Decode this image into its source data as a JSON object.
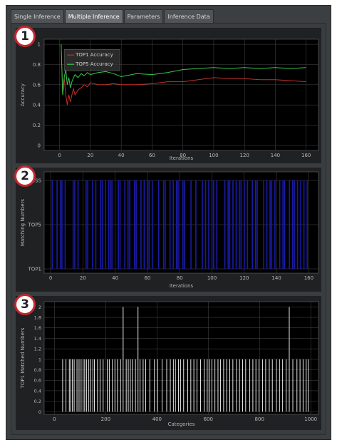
{
  "tabs": [
    {
      "label": "Single Inference"
    },
    {
      "label": "Multiple Inference"
    },
    {
      "label": "Parameters"
    },
    {
      "label": "Inference Data"
    }
  ],
  "active_tab": 1,
  "markers": [
    "1",
    "2",
    "3"
  ],
  "chart_data": [
    {
      "type": "line",
      "xlabel": "Iterations",
      "ylabel": "Accuracy",
      "xlim": [
        -10,
        168
      ],
      "ylim": [
        -0.05,
        1.05
      ],
      "xticks": [
        "0",
        "20",
        "40",
        "60",
        "80",
        "100",
        "120",
        "140",
        "160"
      ],
      "yticks": [
        "0",
        "0.2",
        "0.4",
        "0.6",
        "0.8",
        "1"
      ],
      "legend": [
        "TOP1 Accuracy",
        "TOP5 Accuracy"
      ],
      "legend_position": "top-left",
      "grid": true,
      "series": [
        {
          "name": "TOP1 Accuracy",
          "color": "#c4302b",
          "x": [
            1,
            2,
            3,
            4,
            5,
            6,
            7,
            8,
            9,
            10,
            12,
            14,
            16,
            18,
            20,
            25,
            30,
            35,
            40,
            50,
            60,
            70,
            80,
            90,
            100,
            110,
            120,
            130,
            140,
            150,
            160
          ],
          "y": [
            1.0,
            0.5,
            0.67,
            0.5,
            0.4,
            0.5,
            0.43,
            0.5,
            0.56,
            0.5,
            0.55,
            0.57,
            0.6,
            0.58,
            0.62,
            0.6,
            0.6,
            0.61,
            0.6,
            0.6,
            0.61,
            0.63,
            0.63,
            0.65,
            0.67,
            0.66,
            0.66,
            0.65,
            0.65,
            0.64,
            0.63
          ]
        },
        {
          "name": "TOP5 Accuracy",
          "color": "#35c94a",
          "x": [
            1,
            2,
            3,
            4,
            5,
            6,
            7,
            8,
            9,
            10,
            12,
            14,
            16,
            18,
            20,
            25,
            30,
            35,
            40,
            50,
            60,
            70,
            80,
            90,
            100,
            110,
            120,
            130,
            140,
            150,
            160
          ],
          "y": [
            1.0,
            0.5,
            0.67,
            0.75,
            0.6,
            0.67,
            0.57,
            0.63,
            0.67,
            0.7,
            0.67,
            0.71,
            0.69,
            0.72,
            0.7,
            0.72,
            0.73,
            0.71,
            0.68,
            0.71,
            0.7,
            0.72,
            0.75,
            0.76,
            0.77,
            0.76,
            0.77,
            0.76,
            0.77,
            0.76,
            0.77
          ]
        }
      ]
    },
    {
      "type": "bar",
      "xlabel": "Iterations",
      "ylabel": "Matching Numbers",
      "xlim": [
        -4,
        166
      ],
      "xticks": [
        "0",
        "20",
        "40",
        "60",
        "80",
        "100",
        "120",
        "140",
        "160"
      ],
      "categories": [
        "TOP1",
        "TOP5",
        "MISS"
      ],
      "grid": true,
      "bar_color": "#1a1aa8",
      "x": [
        1,
        4,
        6,
        7,
        9,
        14,
        15,
        17,
        22,
        23,
        26,
        28,
        31,
        32,
        34,
        36,
        37,
        38,
        42,
        43,
        46,
        48,
        49,
        52,
        53,
        56,
        58,
        60,
        61,
        63,
        67,
        70,
        71,
        74,
        76,
        78,
        79,
        82,
        83,
        87,
        90,
        94,
        96,
        98,
        100,
        101,
        103,
        108,
        110,
        111,
        113,
        115,
        117,
        118,
        120,
        122,
        125,
        127,
        128,
        132,
        134,
        136,
        137,
        139,
        142,
        144,
        145,
        148,
        150,
        151,
        153,
        155,
        157,
        159
      ],
      "values": [
        "MISS",
        "MISS",
        "MISS",
        "MISS",
        "MISS",
        "MISS",
        "MISS",
        "MISS",
        "MISS",
        "MISS",
        "MISS",
        "MISS",
        "MISS",
        "MISS",
        "MISS",
        "MISS",
        "MISS",
        "MISS",
        "MISS",
        "MISS",
        "MISS",
        "MISS",
        "MISS",
        "MISS",
        "MISS",
        "MISS",
        "MISS",
        "MISS",
        "MISS",
        "MISS",
        "MISS",
        "MISS",
        "MISS",
        "MISS",
        "MISS",
        "MISS",
        "MISS",
        "MISS",
        "MISS",
        "MISS",
        "MISS",
        "MISS",
        "MISS",
        "MISS",
        "MISS",
        "MISS",
        "MISS",
        "MISS",
        "MISS",
        "MISS",
        "MISS",
        "MISS",
        "MISS",
        "MISS",
        "MISS",
        "MISS",
        "MISS",
        "MISS",
        "MISS",
        "MISS",
        "MISS",
        "MISS",
        "MISS",
        "MISS",
        "MISS",
        "MISS",
        "MISS",
        "MISS",
        "MISS",
        "MISS",
        "MISS",
        "MISS",
        "MISS",
        "MISS"
      ]
    },
    {
      "type": "bar",
      "xlabel": "Categories",
      "ylabel": "TOP1 Matched Numbers",
      "xlim": [
        -40,
        1030
      ],
      "ylim": [
        -0.05,
        2.1
      ],
      "xticks": [
        "0",
        "200",
        "400",
        "600",
        "800",
        "1000"
      ],
      "yticks": [
        "0",
        "0.2",
        "0.4",
        "0.6",
        "0.8",
        "1",
        "1.2",
        "1.4",
        "1.6",
        "1.8",
        "2"
      ],
      "grid": true,
      "bar_color": "#e8e8e8",
      "x": [
        32,
        45,
        58,
        64,
        70,
        77,
        88,
        96,
        104,
        112,
        118,
        125,
        134,
        142,
        150,
        156,
        168,
        178,
        190,
        206,
        214,
        226,
        236,
        246,
        258,
        268,
        280,
        288,
        296,
        304,
        316,
        326,
        334,
        346,
        356,
        372,
        390,
        402,
        420,
        438,
        452,
        464,
        472,
        484,
        492,
        504,
        520,
        532,
        544,
        556,
        570,
        584,
        596,
        604,
        614,
        626,
        638,
        648,
        660,
        672,
        684,
        696,
        710,
        722,
        734,
        746,
        762,
        774,
        786,
        798,
        812,
        824,
        838,
        850,
        866,
        878,
        890,
        904,
        916,
        930,
        946,
        958,
        970,
        982,
        990
      ],
      "values": [
        1,
        1,
        1,
        1,
        1,
        1,
        1,
        1,
        1,
        1,
        1,
        1,
        1,
        1,
        1,
        1,
        1,
        1,
        1,
        1,
        1,
        1,
        1,
        1,
        1,
        2,
        1,
        1,
        1,
        1,
        1,
        2,
        1,
        1,
        1,
        1,
        1,
        1,
        1,
        1,
        1,
        1,
        1,
        1,
        1,
        1,
        1,
        1,
        1,
        1,
        1,
        1,
        1,
        1,
        1,
        1,
        1,
        1,
        1,
        1,
        1,
        1,
        1,
        1,
        1,
        1,
        1,
        1,
        1,
        1,
        1,
        1,
        1,
        1,
        1,
        1,
        1,
        1,
        2,
        1,
        1,
        1,
        1,
        1,
        1
      ]
    }
  ]
}
